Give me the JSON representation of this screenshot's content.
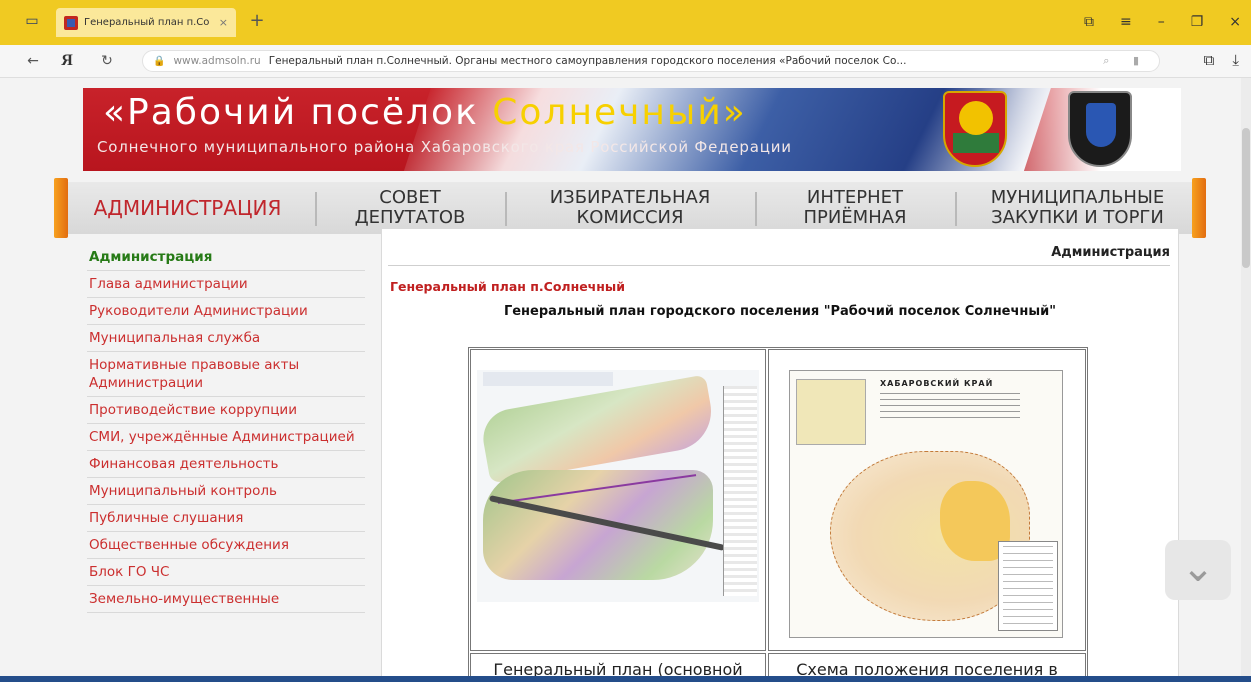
{
  "browser": {
    "tab_title": "Генеральный план п.Со",
    "tab_close": "×",
    "tab_new": "+",
    "app_icon": "▭",
    "window_controls": [
      "⧉",
      "≡",
      "–",
      "❐",
      "×"
    ],
    "nav": {
      "back": "←",
      "brand": "Я",
      "reload": "↻"
    },
    "lock_icon": "🔒",
    "url_domain": "www.admsoln.ru",
    "page_title": "Генеральный план п.Солнечный. Органы местного самоуправления городского поселения «Рабочий поселок Со...",
    "field_icons": "⌕ ▮",
    "right_icons": [
      "⧉",
      "⤓"
    ]
  },
  "site": {
    "banner_title_prefix": "«Рабочий посёлок ",
    "banner_title_accent": "Солнечный»",
    "banner_subtitle": "Солнечного муниципального района Хабаровского края Российской Федерации",
    "nav": [
      {
        "label": "АДМИНИСТРАЦИЯ"
      },
      {
        "label": "СОВЕТ ДЕПУТАТОВ"
      },
      {
        "label": "ИЗБИРАТЕЛЬНАЯ КОМИССИЯ"
      },
      {
        "label": "ИНТЕРНЕТ ПРИЁМНАЯ"
      },
      {
        "label": "МУНИЦИПАЛЬНЫЕ ЗАКУПКИ И ТОРГИ"
      }
    ],
    "sidebar": [
      "Администрация",
      "Глава администрации",
      "Руководители Администрации",
      "Муниципальная служба",
      "Нормативные правовые акты Администрации",
      "Противодействие коррупции",
      "СМИ, учреждённые Администрацией",
      "Финансовая деятельность",
      "Муниципальный контроль",
      "Публичные слушания",
      "Общественные обсуждения",
      "Блок ГО ЧС",
      "Земельно-имущественные"
    ],
    "content": {
      "section_heading": "Администрация",
      "article_title": "Генеральный план п.Солнечный",
      "article_subtitle": "Генеральный план городского поселения \"Рабочий поселок Солнечный\"",
      "map2_title": "ХАБАРОВСКИЙ КРАЙ",
      "captions": [
        "Генеральный план (основной",
        "Схема положения поселения в"
      ]
    },
    "scroll_icon": "⌄"
  },
  "colors": {
    "chrome_yellow": "#f0ca22",
    "accent_red": "#c0262c",
    "sidebar_link": "#cb2f2f",
    "sidebar_active": "#267a16"
  }
}
